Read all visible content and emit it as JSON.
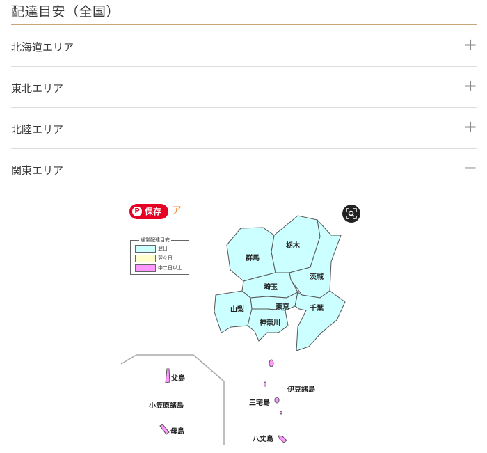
{
  "page": {
    "title": "配達目安（全国）"
  },
  "accordion": [
    {
      "label": "北海道エリア",
      "toggle": "+"
    },
    {
      "label": "東北エリア",
      "toggle": "+"
    },
    {
      "label": "北陸エリア",
      "toggle": "+"
    },
    {
      "label": "関東エリア",
      "toggle": "−"
    }
  ],
  "map": {
    "pin_button_label": "保存",
    "pin_icon": "pinterest-icon",
    "partial_caption": "ア",
    "visual_search_icon": "lens-search-icon",
    "legend": {
      "title": "通常配達目安",
      "items": [
        {
          "label": "翌日",
          "color": "#ccffff"
        },
        {
          "label": "翌々日",
          "color": "#ffffcc"
        },
        {
          "label": "中二日以上",
          "color": "#ff99ff"
        }
      ]
    },
    "prefectures": {
      "gunma": "群馬",
      "tochigi": "栃木",
      "ibaraki": "茨城",
      "saitama": "埼玉",
      "tokyo": "東京",
      "chiba": "千葉",
      "yamanashi": "山梨",
      "kanagawa": "神奈川"
    },
    "islands": {
      "chichijima": "父島",
      "ogasawara": "小笠原諸島",
      "hahajima": "母島",
      "izu": "伊豆諸島",
      "miyake": "三宅島",
      "hachijo": "八丈島"
    },
    "colors": {
      "next_day": "#ccffff",
      "multi_day": "#ff99ff",
      "accent": "#c8a679"
    }
  }
}
